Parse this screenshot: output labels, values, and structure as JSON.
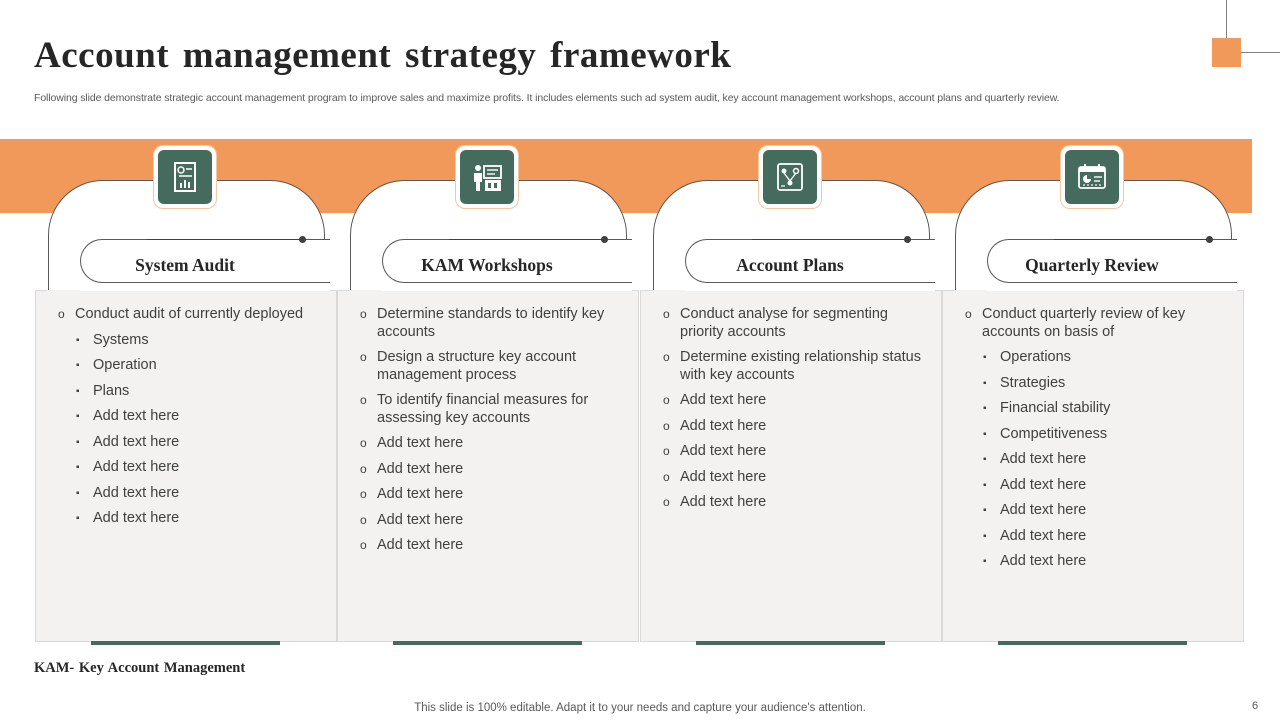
{
  "header": {
    "title": "Account management strategy framework",
    "subtitle": "Following slide demonstrate strategic account management program to improve sales and maximize profits. It includes elements such ad system audit, key account management workshops, account plans and quarterly review."
  },
  "colors": {
    "accent": "#f0995a",
    "icon_bg": "#456a5e",
    "panel_bg": "#f3f2f0"
  },
  "columns": [
    {
      "heading": "System Audit",
      "icon": "audit-report-icon",
      "items": [
        {
          "text": "Conduct audit of currently deployed",
          "level": 1
        },
        {
          "text": "Systems",
          "level": 2
        },
        {
          "text": "Operation",
          "level": 2
        },
        {
          "text": "Plans",
          "level": 2
        },
        {
          "text": "Add text here",
          "level": 2
        },
        {
          "text": "Add text here",
          "level": 2
        },
        {
          "text": "Add text here",
          "level": 2
        },
        {
          "text": "Add text here",
          "level": 2
        },
        {
          "text": "Add text here",
          "level": 2
        }
      ]
    },
    {
      "heading": "KAM Workshops",
      "icon": "workshop-presenter-icon",
      "items": [
        {
          "text": "Determine standards to identify key accounts",
          "level": 1
        },
        {
          "text": "Design a structure key account management process",
          "level": 1
        },
        {
          "text": "To identify financial measures for assessing key accounts",
          "level": 1
        },
        {
          "text": "Add text here",
          "level": 1
        },
        {
          "text": "Add text here",
          "level": 1
        },
        {
          "text": "Add text here",
          "level": 1
        },
        {
          "text": "Add text here",
          "level": 1
        },
        {
          "text": "Add text here",
          "level": 1
        }
      ]
    },
    {
      "heading": "Account Plans",
      "icon": "account-plan-icon",
      "items": [
        {
          "text": "Conduct analyse for segmenting priority accounts",
          "level": 1
        },
        {
          "text": "Determine existing relationship status with key accounts",
          "level": 1
        },
        {
          "text": "Add text here",
          "level": 1
        },
        {
          "text": "Add text here",
          "level": 1
        },
        {
          "text": "Add text here",
          "level": 1
        },
        {
          "text": "Add text here",
          "level": 1
        },
        {
          "text": "Add text here",
          "level": 1
        }
      ]
    },
    {
      "heading": "Quarterly Review",
      "icon": "calendar-review-icon",
      "items": [
        {
          "text": "Conduct quarterly review of key accounts on basis of",
          "level": 1
        },
        {
          "text": "Operations",
          "level": 2
        },
        {
          "text": "Strategies",
          "level": 2
        },
        {
          "text": "Financial stability",
          "level": 2
        },
        {
          "text": "Competitiveness",
          "level": 2
        },
        {
          "text": "Add text here",
          "level": 2
        },
        {
          "text": "Add text here",
          "level": 2
        },
        {
          "text": "Add text here",
          "level": 2
        },
        {
          "text": "Add text here",
          "level": 2
        },
        {
          "text": "Add text here",
          "level": 2
        }
      ]
    }
  ],
  "footnote": "KAM- Key Account  Management",
  "footer": "This slide is 100% editable. Adapt it to your needs and capture your audience's attention.",
  "page_number": "6"
}
